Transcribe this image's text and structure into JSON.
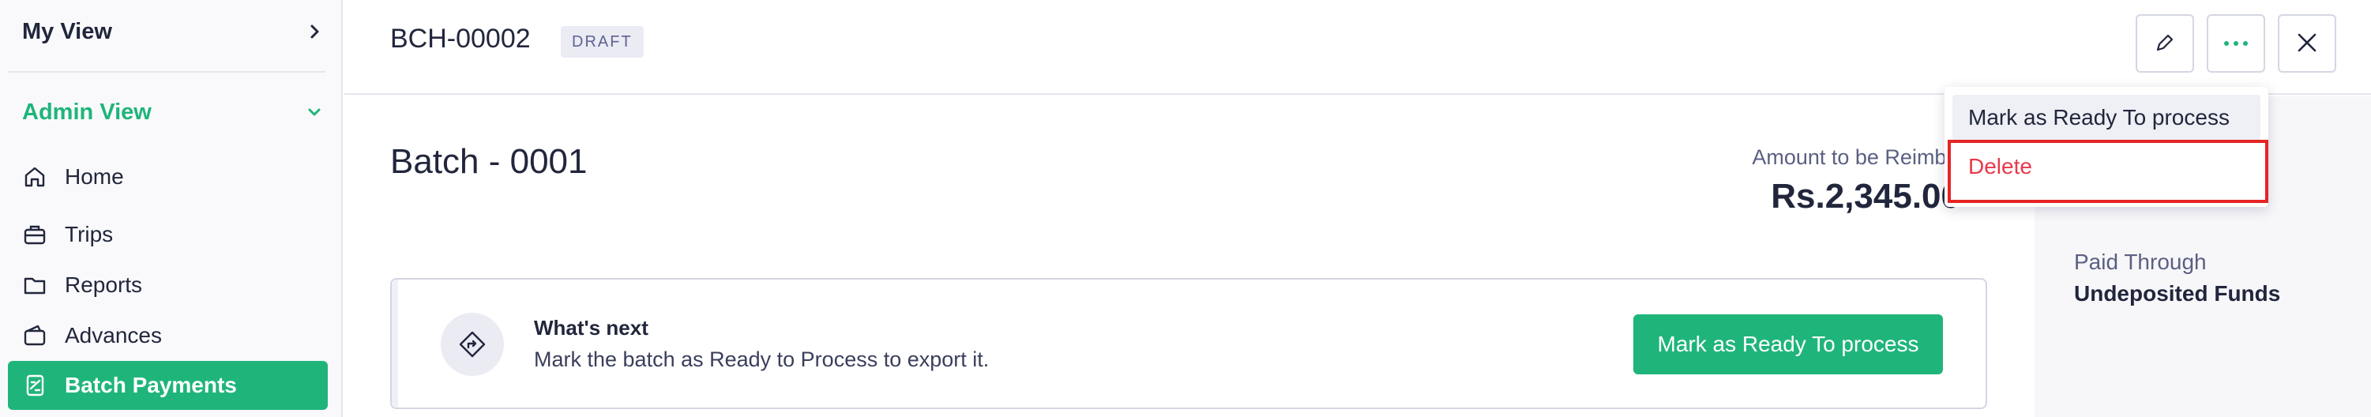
{
  "sidebar": {
    "my_view": "My View",
    "admin_view": "Admin View",
    "items": [
      {
        "label": "Home",
        "icon": "home-icon"
      },
      {
        "label": "Trips",
        "icon": "briefcase-icon"
      },
      {
        "label": "Reports",
        "icon": "folder-icon"
      },
      {
        "label": "Advances",
        "icon": "wallet-icon"
      },
      {
        "label": "Batch Payments",
        "icon": "batch-payments-icon",
        "active": true
      }
    ]
  },
  "header": {
    "doc_id": "BCH-00002",
    "status_badge": "DRAFT"
  },
  "main": {
    "title": "Batch - 0001",
    "amount_label": "Amount to be Reimbursed",
    "amount_value": "Rs.2,345.00"
  },
  "details": {
    "paid_through_label": "Paid Through",
    "paid_through_value": "Undeposited Funds"
  },
  "whats_next": {
    "title": "What's next",
    "description": "Mark the batch as Ready to Process to export it.",
    "button_label": "Mark as Ready To process"
  },
  "menu": {
    "ready_label": "Mark as Ready To process",
    "delete_label": "Delete"
  },
  "colors": {
    "accent": "#1fb57a",
    "danger": "#e8394a",
    "highlight": "#e52424"
  }
}
